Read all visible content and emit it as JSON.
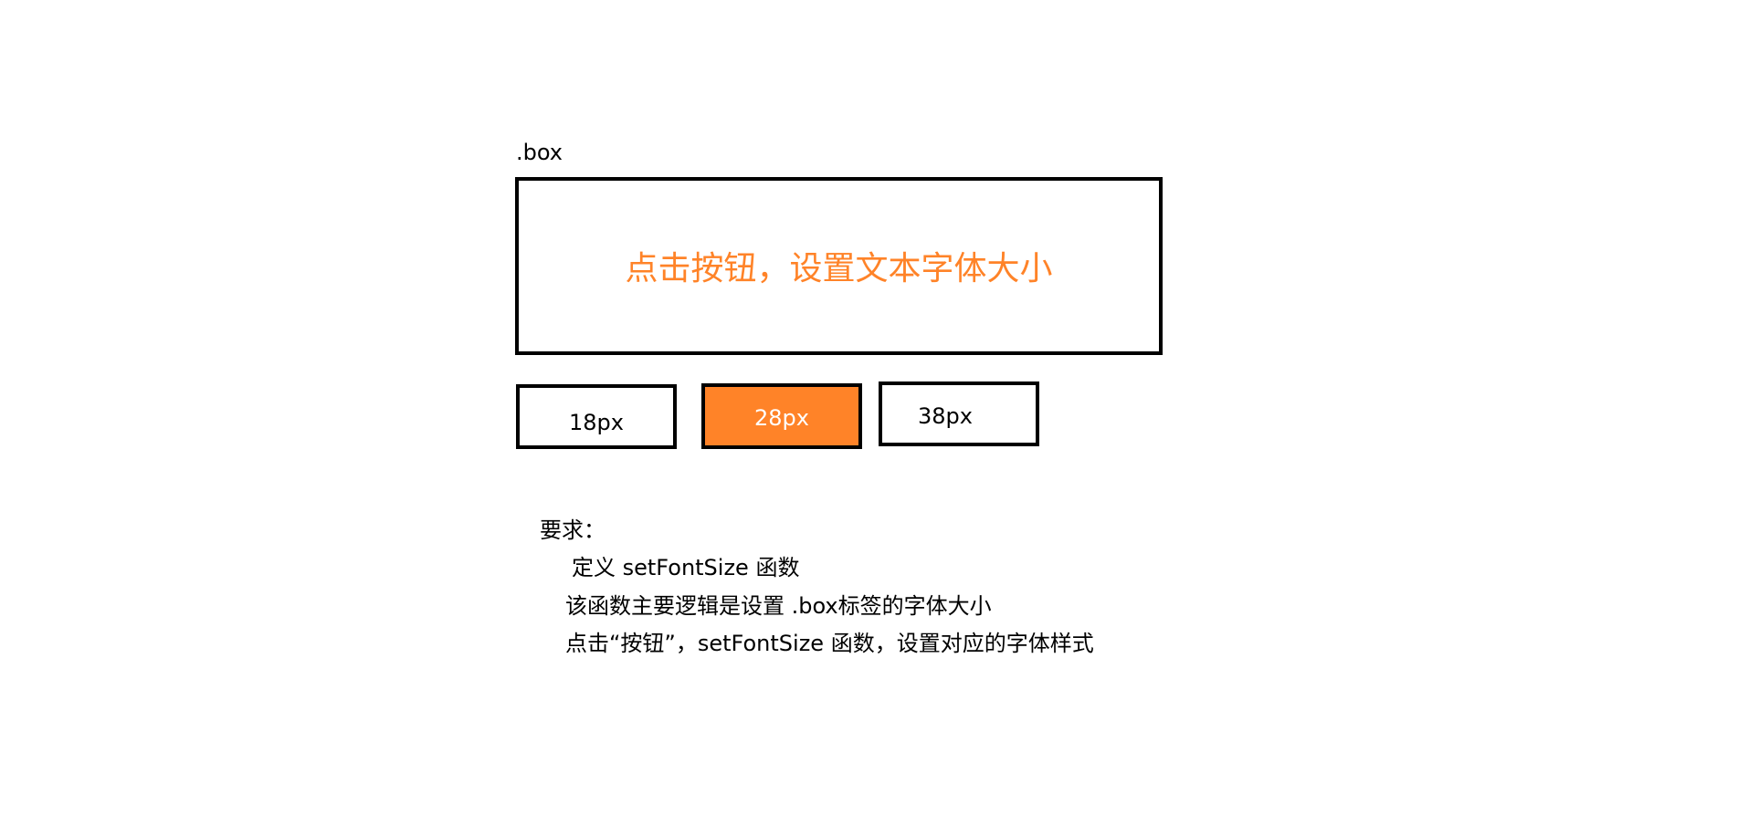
{
  "box_label": ".box",
  "main_text": "点击按钮，设置文本字体大小",
  "buttons": [
    {
      "label": "18px"
    },
    {
      "label": "28px"
    },
    {
      "label": "38px"
    }
  ],
  "requirements": {
    "title": "要求：",
    "lines": [
      "定义  setFontSize 函数",
      "该函数主要逻辑是设置 .box标签的字体大小",
      "点击“按钮”，setFontSize 函数，设置对应的字体样式"
    ]
  },
  "colors": {
    "accent": "#FF8328",
    "border": "#000000",
    "background": "#FFFFFF"
  }
}
